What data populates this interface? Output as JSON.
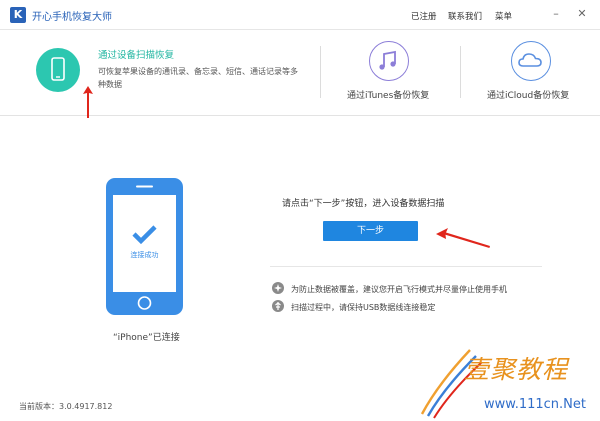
{
  "titlebar": {
    "logo_letter": "K",
    "app_title": "开心手机恢复大师",
    "registered": "已注册",
    "contact": "联系我们",
    "menu": "菜单"
  },
  "modes": {
    "device_scan": {
      "title": "通过设备扫描恢复",
      "desc": "可恢复苹果设备的通讯录、备忘录、短信、通话记录等多种数据"
    },
    "itunes": {
      "label": "通过iTunes备份恢复"
    },
    "icloud": {
      "label": "通过iCloud备份恢复"
    }
  },
  "main": {
    "phone_screen_text": "连接成功",
    "phone_caption": "“iPhone”已连接",
    "prompt": "请点击“下一步”按钮，进入设备数据扫描",
    "next_button": "下一步",
    "tips": [
      "为防止数据被覆盖，建议您开启飞行模式并尽量停止使用手机",
      "扫描过程中，请保持USB数据线连接稳定"
    ]
  },
  "footer": {
    "version": "当前版本：3.0.4917.812"
  },
  "watermark": {
    "text": "壹聚教程",
    "url": "www.111cn.Net"
  },
  "colors": {
    "brand_blue": "#2a63b8",
    "teal": "#2cc7b0",
    "button_blue": "#1f86e0",
    "arrow_red": "#e0261c"
  }
}
